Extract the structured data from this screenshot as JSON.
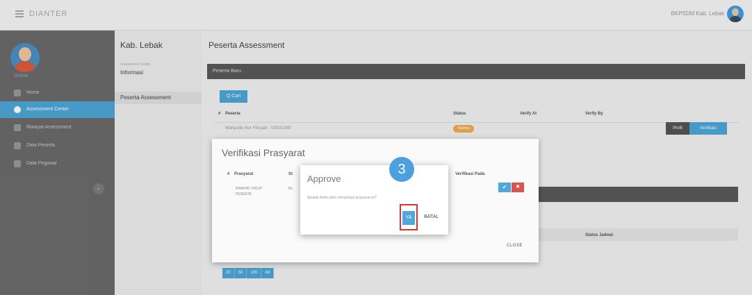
{
  "topbar": {
    "brand": "DIANTER",
    "user_name": "BKPSDM Kab. Lebak"
  },
  "sidebar": {
    "status": "Online",
    "items": [
      {
        "label": "Home"
      },
      {
        "label": "Assessment Center",
        "active": true
      },
      {
        "label": "Riwayat Assessment"
      },
      {
        "label": "Data Peserta"
      },
      {
        "label": "Data Pegawai"
      }
    ],
    "collapse": "«"
  },
  "subnav": {
    "title": "Kab. Lebak",
    "small": "Assessment Center",
    "links": [
      {
        "label": "Informasi"
      },
      {
        "label": "Peserta Assessment",
        "selected": true
      }
    ]
  },
  "main": {
    "title": "Peserta Assessment",
    "panel_title": "Peserta Baru",
    "search_button": "Q Cari",
    "table": {
      "headers": [
        "#",
        "Peserta",
        "Status",
        "Verify At",
        "Verify By"
      ],
      "rows": [
        {
          "peserta": "Wahyudin Nur Fitriyadi - 02/03/1987",
          "status": "Waiting"
        }
      ]
    },
    "profil_button": "Profil",
    "verifikasi_button": "Verifikasi",
    "status_jadwal": "Status Jadwal",
    "pager": [
      "20",
      "50",
      "100",
      "All"
    ]
  },
  "modal": {
    "title": "Verifikasi Prasyarat",
    "headers": [
      "#",
      "Prasyarat",
      "St",
      "Verifikasi Pada"
    ],
    "row": {
      "prasyarat": "RIWAYAT HIDUP PESERTA",
      "status": "Be"
    },
    "close": "CLOSE"
  },
  "approve": {
    "title": "Approve",
    "message": "Apakah Anda yakin menyetujui prasyarat ini?",
    "yes": "YA",
    "no": "BATAL",
    "step": "3"
  },
  "colors": {
    "accent": "#4ea8da",
    "danger": "#d9534f",
    "warning": "#f0ad4e",
    "highlight": "#e03030"
  }
}
